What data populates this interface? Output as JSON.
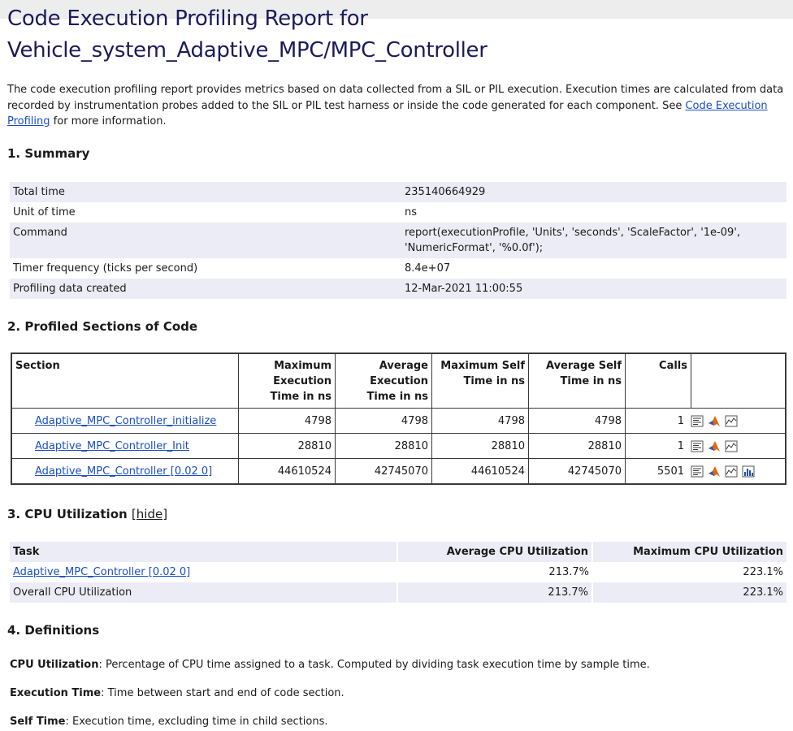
{
  "title": "Code Execution Profiling Report for Vehicle_system_Adaptive_MPC/MPC_Controller",
  "intro": {
    "text_before": "The code execution profiling report provides metrics based on data collected from a SIL or PIL execution. Execution times are calculated from data recorded by instrumentation probes added to the SIL or PIL test harness or inside the code generated for each component. See ",
    "link": "Code Execution Profiling",
    "text_after": " for more information."
  },
  "summary": {
    "heading": "1. Summary",
    "rows": [
      {
        "key": "Total time",
        "value": "235140664929"
      },
      {
        "key": "Unit of time",
        "value": "ns"
      },
      {
        "key": "Command",
        "value": "report(executionProfile, 'Units', 'seconds', 'ScaleFactor', '1e-09', 'NumericFormat', '%0.0f');"
      },
      {
        "key": "Timer frequency (ticks per second)",
        "value": "8.4e+07"
      },
      {
        "key": "Profiling data created",
        "value": "12-Mar-2021 11:00:55"
      }
    ]
  },
  "sections": {
    "heading": "2. Profiled Sections of Code",
    "columns": [
      "Section",
      "Maximum Execution Time in ns",
      "Average Execution Time in ns",
      "Maximum Self Time in ns",
      "Average Self Time in ns",
      "Calls"
    ],
    "rows": [
      {
        "name": "Adaptive_MPC_Controller_initialize",
        "max_exec": "4798",
        "avg_exec": "4798",
        "max_self": "4798",
        "avg_self": "4798",
        "calls": "1"
      },
      {
        "name": "Adaptive_MPC_Controller_Init",
        "max_exec": "28810",
        "avg_exec": "28810",
        "max_self": "28810",
        "avg_self": "28810",
        "calls": "1"
      },
      {
        "name": "Adaptive_MPC_Controller [0.02 0]",
        "max_exec": "44610524",
        "avg_exec": "42745070",
        "max_self": "44610524",
        "avg_self": "42745070",
        "calls": "5501"
      }
    ],
    "icons": [
      "code-icon",
      "matlab-icon",
      "timeline-icon",
      "histogram-icon"
    ]
  },
  "cpu": {
    "heading": "3. CPU Utilization",
    "hide_label": "[hide]",
    "columns": [
      "Task",
      "Average CPU Utilization",
      "Maximum CPU Utilization"
    ],
    "rows": [
      {
        "task": "Adaptive_MPC_Controller [0.02 0]",
        "avg": "213.7%",
        "max": "223.1%"
      },
      {
        "task": "Overall CPU Utilization",
        "avg": "213.7%",
        "max": "223.1%"
      }
    ]
  },
  "definitions": {
    "heading": "4. Definitions",
    "items": [
      {
        "term": "CPU Utilization",
        "text": ": Percentage of CPU time assigned to a task. Computed by dividing task execution time by sample time."
      },
      {
        "term": "Execution Time",
        "text": ": Time between start and end of code section."
      },
      {
        "term": "Self Time",
        "text": ": Execution time, excluding time in child sections."
      }
    ]
  },
  "colors": {
    "title": "#1b1b5a",
    "link": "#1a4ec2",
    "row_alt": "#ececf6"
  }
}
